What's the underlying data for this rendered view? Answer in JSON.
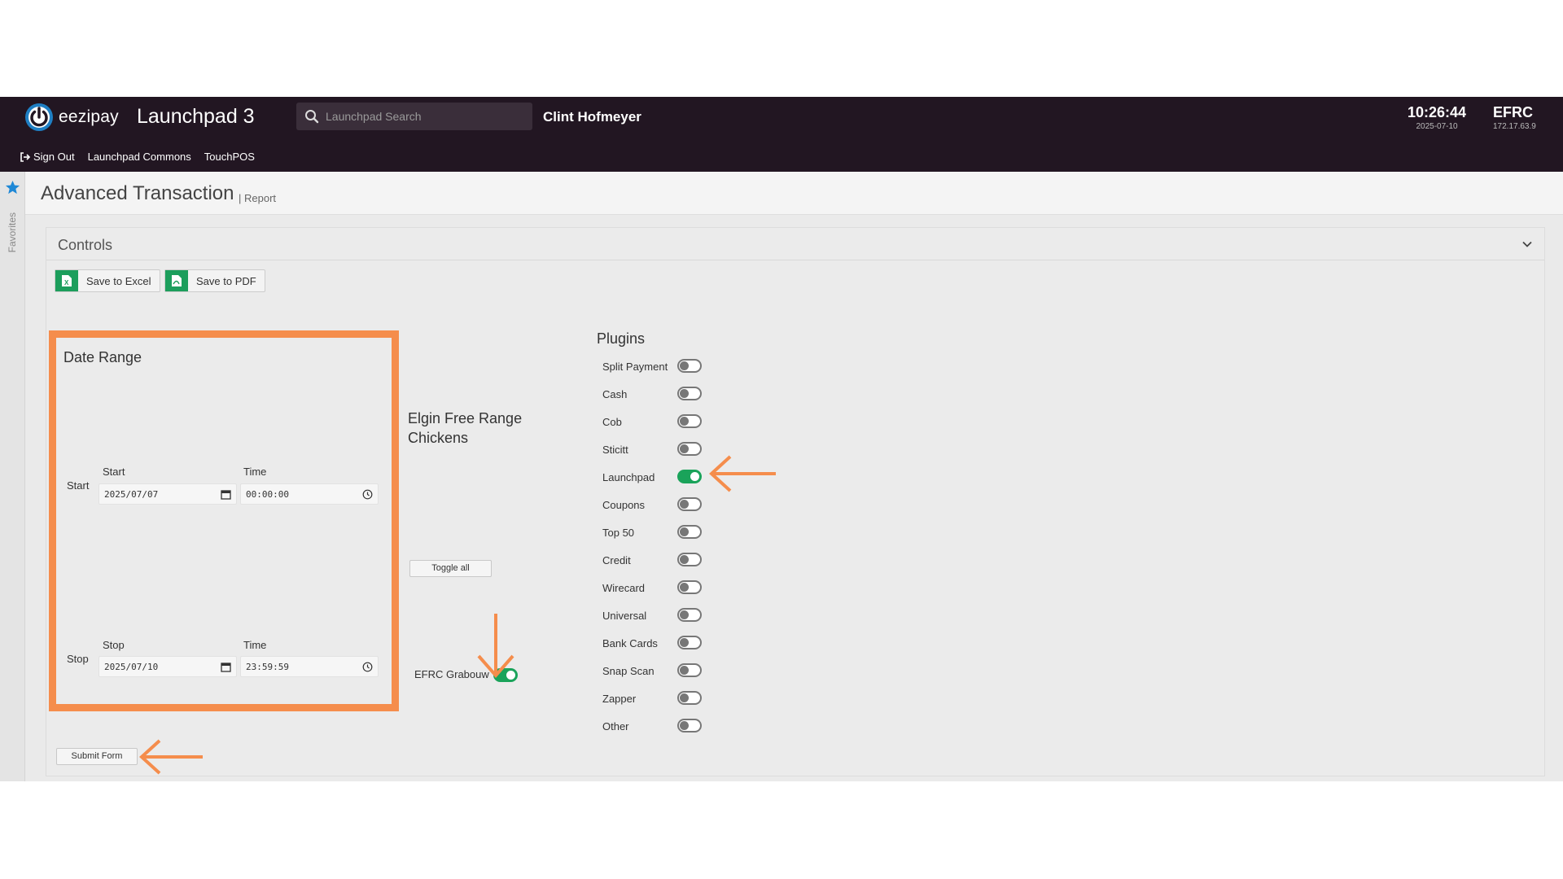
{
  "header": {
    "brand": "eezipay",
    "app_title": "Launchpad 3",
    "search_placeholder": "Launchpad Search",
    "user": "Clint Hofmeyer",
    "time": "10:26:44",
    "date": "2025-07-10",
    "site_name": "EFRC",
    "site_ip": "172.17.63.9",
    "nav": [
      "Sign Out",
      "Launchpad Commons",
      "TouchPOS"
    ]
  },
  "sidebar": {
    "favorites_label": "Favorites"
  },
  "page": {
    "title": "Advanced Transaction",
    "subtitle": "| Report"
  },
  "controls": {
    "title": "Controls",
    "save_excel": "Save to Excel",
    "save_pdf": "Save to PDF",
    "submit": "Submit Form"
  },
  "date_range": {
    "title": "Date Range",
    "start": {
      "row_label": "Start",
      "date_label": "Start",
      "time_label": "Time",
      "date_value": "2025/07/07",
      "time_value": "00:00:00"
    },
    "stop": {
      "row_label": "Stop",
      "date_label": "Stop",
      "time_label": "Time",
      "date_value": "2025/07/10",
      "time_value": "23:59:59"
    }
  },
  "organisation": {
    "name": "Elgin Free Range Chickens",
    "toggle_all": "Toggle all",
    "site_toggle_label": "EFRC Grabouw",
    "site_toggle_on": true
  },
  "plugins": {
    "title": "Plugins",
    "items": [
      {
        "label": "Split Payment",
        "on": false
      },
      {
        "label": "Cash",
        "on": false
      },
      {
        "label": "Cob",
        "on": false
      },
      {
        "label": "Sticitt",
        "on": false
      },
      {
        "label": "Launchpad",
        "on": true
      },
      {
        "label": "Coupons",
        "on": false
      },
      {
        "label": "Top 50",
        "on": false
      },
      {
        "label": "Credit",
        "on": false
      },
      {
        "label": "Wirecard",
        "on": false
      },
      {
        "label": "Universal",
        "on": false
      },
      {
        "label": "Bank Cards",
        "on": false
      },
      {
        "label": "Snap Scan",
        "on": false
      },
      {
        "label": "Zapper",
        "on": false
      },
      {
        "label": "Other",
        "on": false
      }
    ]
  },
  "colors": {
    "header_bg": "#221622",
    "accent_green": "#1aa35a",
    "annotation_orange": "#f58d4c",
    "favorites_star": "#1e88d6"
  }
}
